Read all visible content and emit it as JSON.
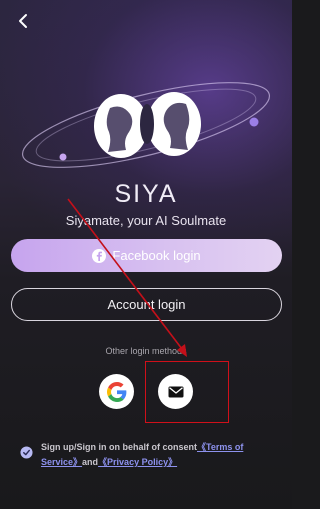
{
  "app": {
    "name": "SIYA",
    "tagline": "Siyamate, your AI Soulmate"
  },
  "icons": {
    "back": "chevron-left-icon",
    "logo": "siya-logo-icon",
    "facebook": "facebook-icon",
    "google": "google-icon",
    "email": "envelope-icon",
    "check": "check-circle-icon"
  },
  "login": {
    "facebook_label": "Facebook login",
    "account_label": "Account login",
    "other_methods_label": "Other login methods"
  },
  "consent": {
    "prefix": "Sign up/Sign in on behalf of consent",
    "terms_link": "《Terms of Service》",
    "joiner": "and",
    "privacy_link": "《Privacy Policy》"
  },
  "colors": {
    "accent_gradient_start": "#c6a4ee",
    "accent_gradient_end": "#e3d2f2",
    "link": "#8d92ee",
    "highlight": "#d0101a"
  }
}
